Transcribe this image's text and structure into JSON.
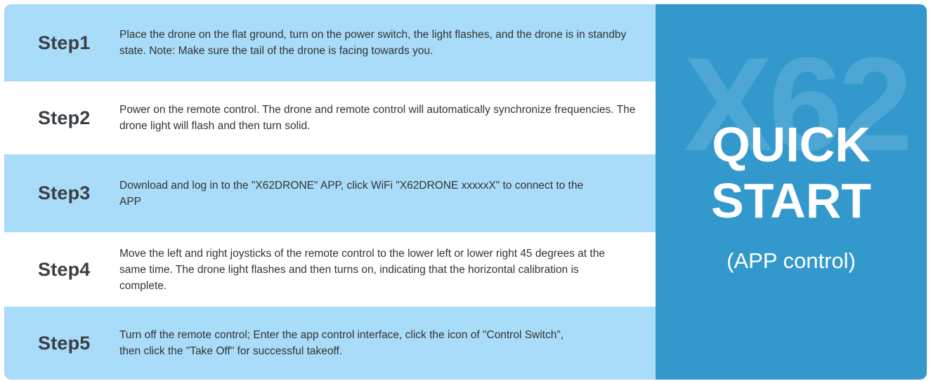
{
  "steps": [
    {
      "label": "Step1",
      "text": "Place the drone on the flat ground, turn on the power switch, the light flashes, and the drone is in standby state. Note: Make sure the tail of the drone is facing towards you."
    },
    {
      "label": "Step2",
      "text": "Power on the remote control. The drone and remote control will automatically synchronize frequencies. The drone light will flash and then turn solid."
    },
    {
      "label": "Step3",
      "text": "Download and log in to the \"X62DRONE\" APP, click WiFi \"X62DRONE xxxxxX\" to connect to the APP"
    },
    {
      "label": "Step4",
      "text": "Move the left and right joysticks of the remote control to the lower left or lower right 45 degrees at the same time. The drone light flashes and then turns on, indicating that the horizontal calibration is complete."
    },
    {
      "label": "Step5",
      "text": "Turn off the remote control; Enter the app control interface, click the icon of \"Control Switch\", then click the \"Take Off\" for successful takeoff."
    }
  ],
  "panel": {
    "watermark": "X62",
    "title_line1": "QUICK",
    "title_line2": "START",
    "subtitle": "(APP control)"
  },
  "colors": {
    "row_blue": "#a8dcf8",
    "row_white": "#ffffff",
    "panel_blue": "#3399cd"
  }
}
